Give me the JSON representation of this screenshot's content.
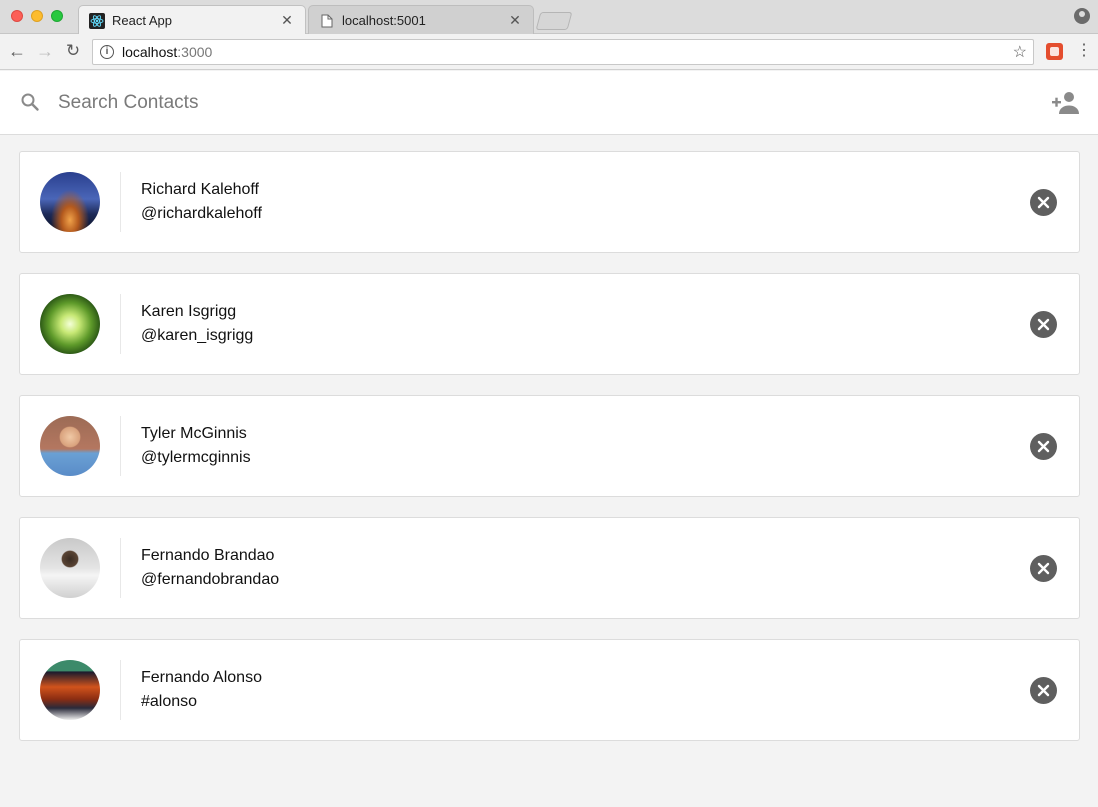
{
  "browser": {
    "tabs": [
      {
        "title": "React App",
        "icon": "react-icon",
        "active": true
      },
      {
        "title": "localhost:5001",
        "icon": "document-icon",
        "active": false
      }
    ],
    "url_host": "localhost",
    "url_port": ":3000"
  },
  "search": {
    "placeholder": "Search Contacts",
    "value": ""
  },
  "contacts": [
    {
      "name": "Richard Kalehoff",
      "handle": "@richardkalehoff"
    },
    {
      "name": "Karen Isgrigg",
      "handle": "@karen_isgrigg"
    },
    {
      "name": "Tyler McGinnis",
      "handle": "@tylermcginnis"
    },
    {
      "name": "Fernando Brandao",
      "handle": "@fernandobrandao"
    },
    {
      "name": "Fernando Alonso",
      "handle": "#alonso"
    }
  ],
  "colors": {
    "remove_button": "#5f5f5f",
    "icon_gray": "#8a8a8a"
  }
}
